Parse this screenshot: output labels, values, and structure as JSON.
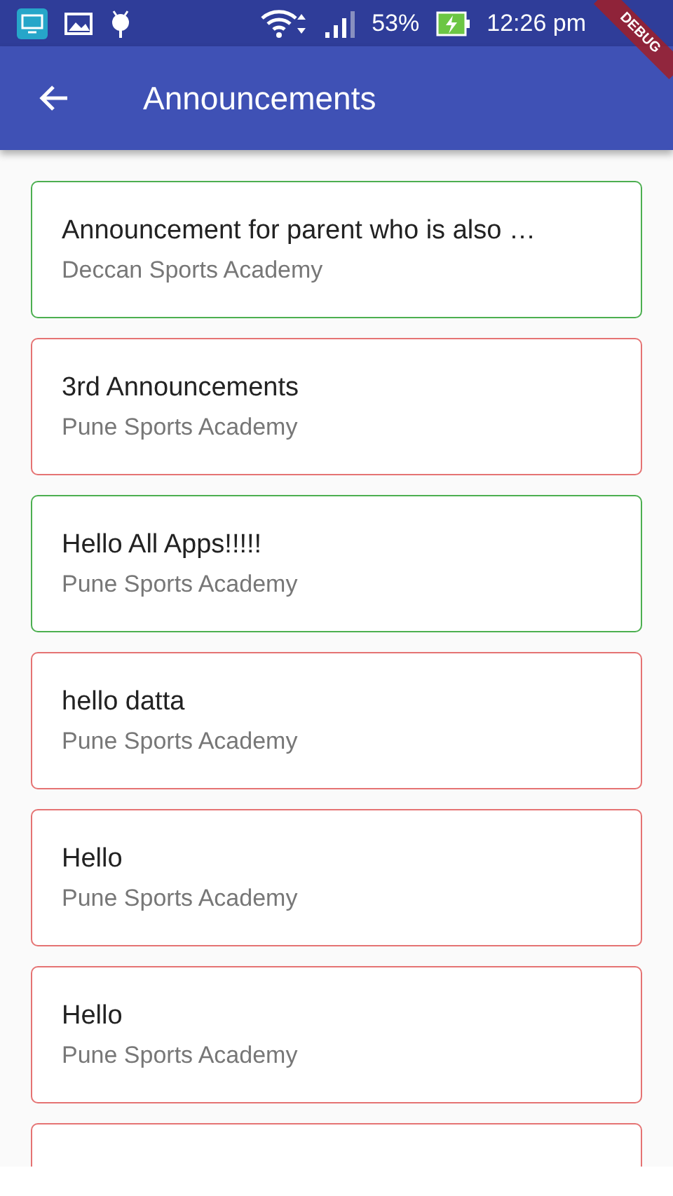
{
  "status_bar": {
    "battery": "53%",
    "time": "12:26 pm"
  },
  "debug_banner": "DEBUG",
  "app_bar": {
    "title": "Announcements"
  },
  "announcements": [
    {
      "title": "Announcement for parent who is also …",
      "academy": "Deccan Sports Academy",
      "color": "#4caf50"
    },
    {
      "title": "3rd Announcements",
      "academy": "Pune Sports Academy",
      "color": "#e57373"
    },
    {
      "title": "Hello All Apps!!!!!",
      "academy": "Pune Sports Academy",
      "color": "#4caf50"
    },
    {
      "title": "hello datta",
      "academy": "Pune Sports Academy",
      "color": "#e57373"
    },
    {
      "title": "Hello",
      "academy": "Pune Sports Academy",
      "color": "#e57373"
    },
    {
      "title": "Hello",
      "academy": "Pune Sports Academy",
      "color": "#e57373"
    },
    {
      "color": "#e57373"
    }
  ]
}
